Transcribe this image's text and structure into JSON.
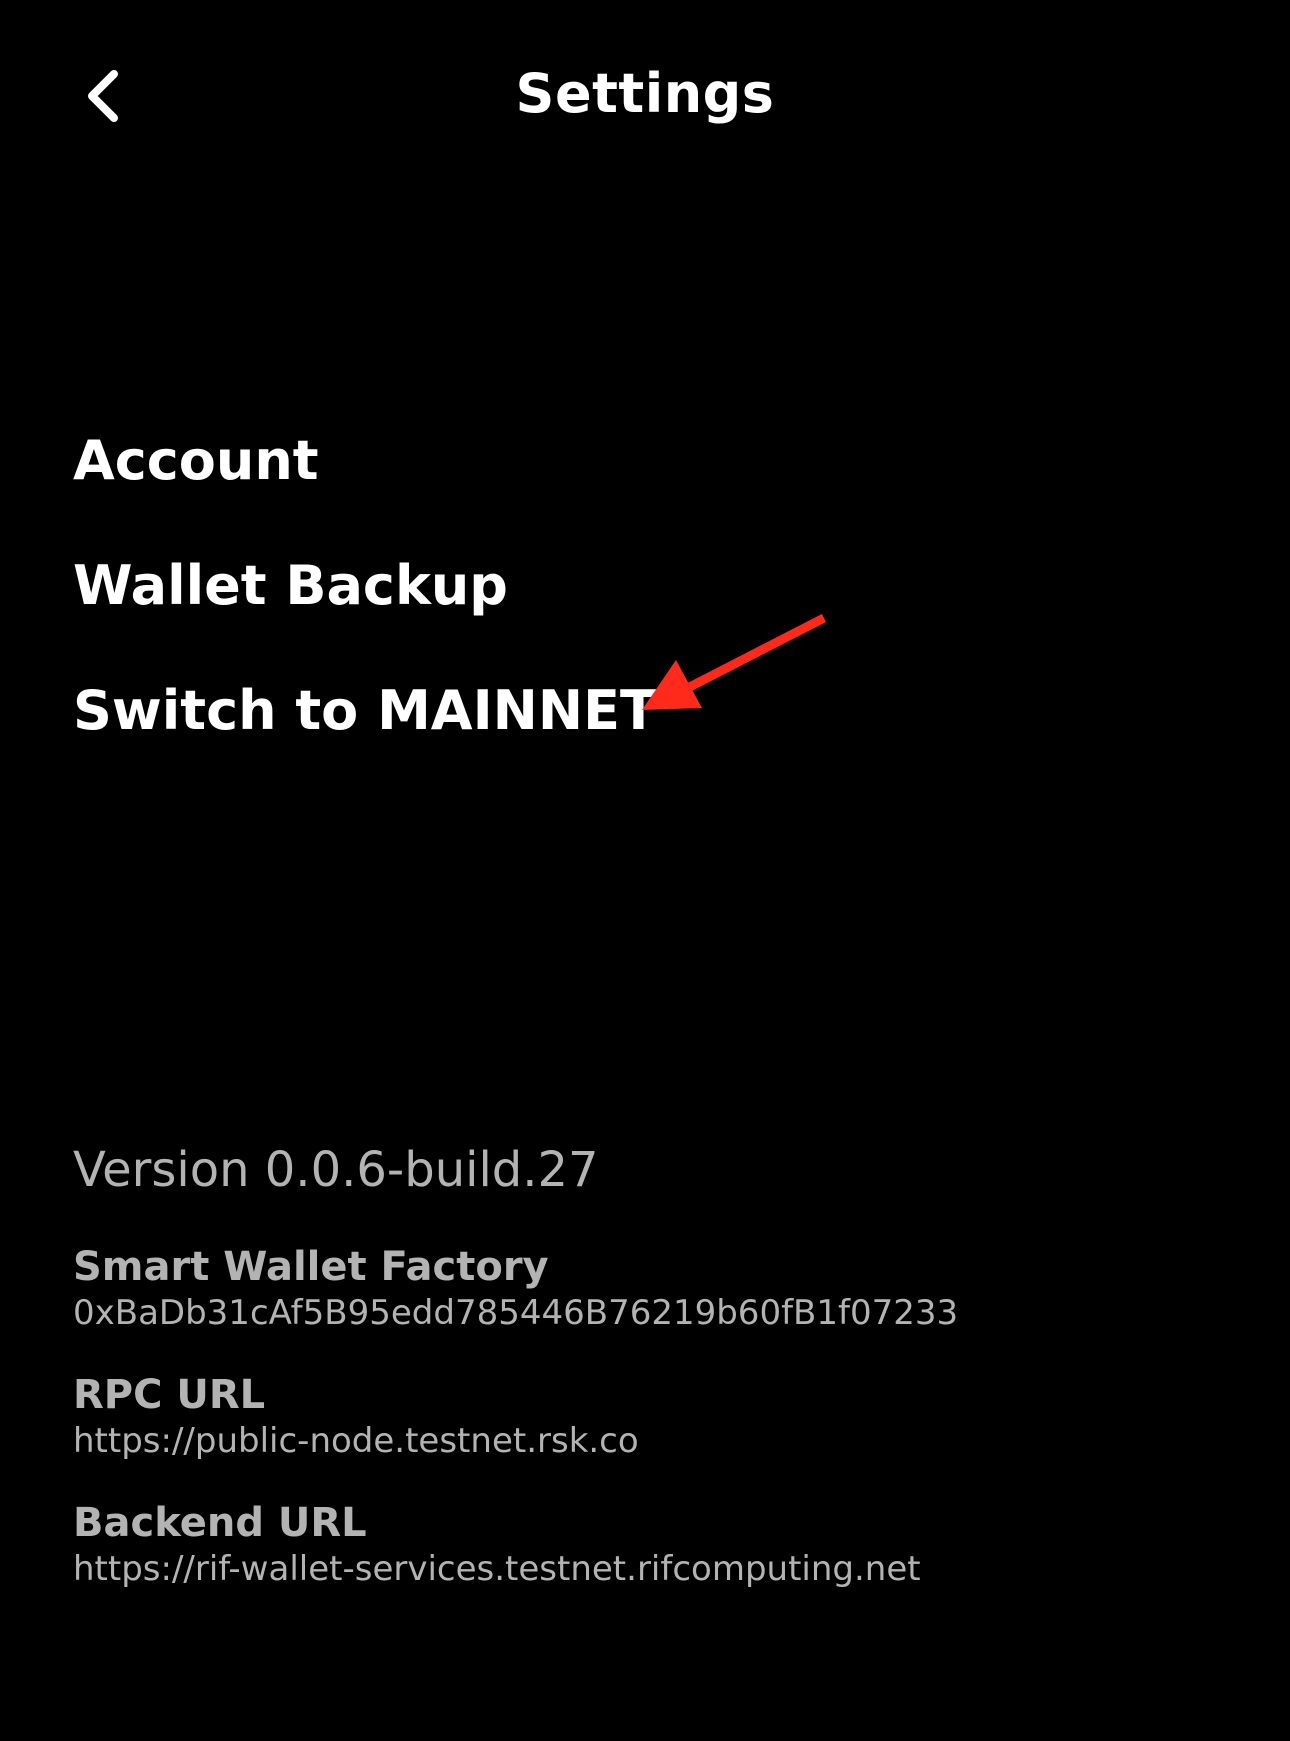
{
  "header": {
    "back_icon": "chevron-left-icon",
    "title": "Settings"
  },
  "menu": {
    "items": [
      {
        "label": "Account"
      },
      {
        "label": "Wallet Backup"
      },
      {
        "label": "Switch to MAINNET"
      }
    ]
  },
  "annotation": {
    "icon": "red-arrow-icon",
    "color": "#ff2a1a"
  },
  "info": {
    "version": "Version 0.0.6-build.27",
    "smart_wallet_factory": {
      "label": "Smart Wallet Factory",
      "value": "0xBaDb31cAf5B95edd785446B76219b60fB1f07233"
    },
    "rpc_url": {
      "label": "RPC URL",
      "value": "https://public-node.testnet.rsk.co"
    },
    "backend_url": {
      "label": "Backend URL",
      "value": "https://rif-wallet-services.testnet.rifcomputing.net"
    }
  },
  "colors": {
    "background": "#000000",
    "primary_text": "#ffffff",
    "secondary_text": "#b3b3b3"
  }
}
